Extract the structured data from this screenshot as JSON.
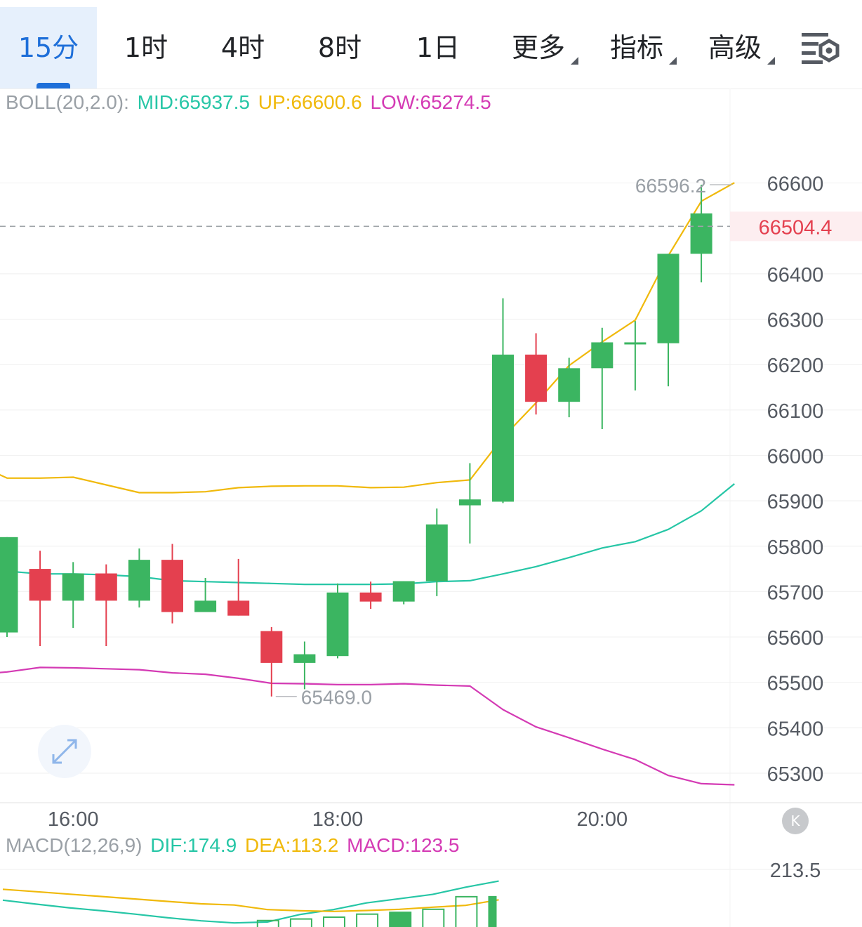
{
  "toolbar": {
    "tabs": [
      {
        "label": "15分",
        "active": true
      },
      {
        "label": "1时"
      },
      {
        "label": "4时"
      },
      {
        "label": "8时"
      },
      {
        "label": "1日"
      }
    ],
    "dropdowns": [
      {
        "label": "更多"
      },
      {
        "label": "指标"
      },
      {
        "label": "高级"
      }
    ],
    "settings_icon": "chart-settings-icon"
  },
  "boll": {
    "name": "BOLL(20,2.0):",
    "mid": "MID:65937.5",
    "up": "UP:66600.6",
    "low": "LOW:65274.5"
  },
  "macd": {
    "name": "MACD(12,26,9)",
    "dif": "DIF:174.9",
    "dea": "DEA:113.2",
    "macd": "MACD:123.5"
  },
  "controls": {
    "expand_icon": "expand-arrows-icon",
    "collapse_label": "K"
  },
  "colors": {
    "up": "#3bb561",
    "down": "#e4404f",
    "mid": "#26c6a6",
    "upper": "#f0b90b",
    "lower": "#d43ab4",
    "axis_text": "#555a62",
    "price_tag": "#e4404f"
  },
  "chart_data": [
    {
      "type": "candlestick",
      "interval": "15分",
      "y_ticks": [
        66600,
        66400,
        66300,
        66200,
        66100,
        66000,
        65900,
        65800,
        65700,
        65600,
        65500,
        65400,
        65300
      ],
      "x_ticks": [
        {
          "label": "16:00",
          "index": 2
        },
        {
          "label": "18:00",
          "index": 10
        },
        {
          "label": "20:00",
          "index": 18
        }
      ],
      "current_price": "66504.4",
      "high_label": "66596.2",
      "low_label": "65469.0",
      "candles": [
        {
          "open": 65610,
          "close": 65820,
          "high": 65820,
          "low": 65600
        },
        {
          "open": 65750,
          "close": 65680,
          "high": 65790,
          "low": 65580
        },
        {
          "open": 65680,
          "close": 65740,
          "high": 65765,
          "low": 65620
        },
        {
          "open": 65740,
          "close": 65680,
          "high": 65760,
          "low": 65580
        },
        {
          "open": 65680,
          "close": 65770,
          "high": 65795,
          "low": 65665
        },
        {
          "open": 65770,
          "close": 65655,
          "high": 65805,
          "low": 65630
        },
        {
          "open": 65655,
          "close": 65680,
          "high": 65730,
          "low": 65655
        },
        {
          "open": 65680,
          "close": 65647,
          "high": 65772,
          "low": 65647
        },
        {
          "open": 65613,
          "close": 65543,
          "high": 65622,
          "low": 65469
        },
        {
          "open": 65543,
          "close": 65562,
          "high": 65590,
          "low": 65485
        },
        {
          "open": 65558,
          "close": 65698,
          "high": 65718,
          "low": 65553
        },
        {
          "open": 65698,
          "close": 65678,
          "high": 65722,
          "low": 65662
        },
        {
          "open": 65678,
          "close": 65723,
          "high": 65723,
          "low": 65672
        },
        {
          "open": 65723,
          "close": 65848,
          "high": 65883,
          "low": 65690
        },
        {
          "open": 65890,
          "close": 65903,
          "high": 65983,
          "low": 65806
        },
        {
          "open": 65898,
          "close": 66222,
          "high": 66346,
          "low": 65895
        },
        {
          "open": 66222,
          "close": 66118,
          "high": 66269,
          "low": 66090
        },
        {
          "open": 66118,
          "close": 66192,
          "high": 66215,
          "low": 66084
        },
        {
          "open": 66192,
          "close": 66249,
          "high": 66281,
          "low": 66058
        },
        {
          "open": 66249,
          "close": 66249,
          "high": 66296,
          "low": 66143
        },
        {
          "open": 66247,
          "close": 66444,
          "high": 66444,
          "low": 66152
        },
        {
          "open": 66444,
          "close": 66533,
          "high": 66596.2,
          "low": 66381
        },
        {
          "open": 66533,
          "close": 66504.4,
          "high": 66533,
          "low": 66504.4
        }
      ],
      "boll_upper": [
        65983,
        65950,
        65950,
        65952,
        65935,
        65918,
        65918,
        65920,
        65929,
        65932,
        65933,
        65933,
        65929,
        65930,
        65940,
        65946,
        66040,
        66116,
        66198,
        66250,
        66298,
        66440,
        66560,
        66600.6
      ],
      "boll_mid": [
        65761,
        65745,
        65739,
        65739,
        65737,
        65733,
        65724,
        65722,
        65720,
        65718,
        65716,
        65716,
        65716,
        65717,
        65722,
        65724,
        65739,
        65755,
        65775,
        65796,
        65810,
        65837,
        65878,
        65937.5
      ],
      "boll_lower": [
        65517,
        65523,
        65533,
        65532,
        65530,
        65528,
        65521,
        65518,
        65509,
        65498,
        65497,
        65495,
        65495,
        65497,
        65494,
        65492,
        65440,
        65402,
        65378,
        65353,
        65330,
        65295,
        65277,
        65274.5
      ]
    },
    {
      "type": "bar",
      "title": "MACD(12,26,9)",
      "y_ticks": [
        213.5
      ],
      "dif": [
        112,
        99,
        87,
        77,
        66,
        54,
        44,
        37,
        40,
        65,
        81,
        103,
        117,
        131,
        155,
        175
      ],
      "dea": [
        148,
        140,
        132,
        124,
        116,
        108,
        100,
        96,
        81,
        77,
        75,
        78,
        82,
        89,
        95,
        113.2
      ],
      "macd_bars": [
        68,
        70,
        72,
        74,
        76,
        76,
        74,
        72,
        45,
        50,
        56,
        66,
        72,
        82,
        123.5,
        123.5
      ]
    }
  ]
}
